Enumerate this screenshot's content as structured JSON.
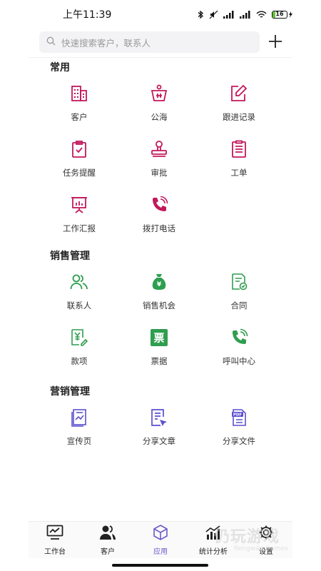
{
  "status_bar": {
    "time": "上午11:39",
    "battery": "16"
  },
  "search": {
    "placeholder": "快速搜索客户，联系人"
  },
  "sections": [
    {
      "title": "常用",
      "items": [
        {
          "label": "客户",
          "icon": "building-icon",
          "color": "#c2185b"
        },
        {
          "label": "公海",
          "icon": "pool-basket-icon",
          "color": "#c2185b"
        },
        {
          "label": "跟进记录",
          "icon": "edit-note-icon",
          "color": "#c2185b"
        },
        {
          "label": "任务提醒",
          "icon": "task-clipboard-icon",
          "color": "#c2185b"
        },
        {
          "label": "审批",
          "icon": "stamp-icon",
          "color": "#c2185b"
        },
        {
          "label": "工单",
          "icon": "work-order-icon",
          "color": "#c2185b"
        },
        {
          "label": "工作汇报",
          "icon": "report-board-icon",
          "color": "#c2185b"
        },
        {
          "label": "拨打电话",
          "icon": "phone-call-icon",
          "color": "#c2185b"
        }
      ]
    },
    {
      "title": "销售管理",
      "items": [
        {
          "label": "联系人",
          "icon": "contacts-icon",
          "color": "#2e9e4f"
        },
        {
          "label": "销售机会",
          "icon": "money-bag-icon",
          "color": "#2e9e4f"
        },
        {
          "label": "合同",
          "icon": "contract-icon",
          "color": "#2e9e4f"
        },
        {
          "label": "款项",
          "icon": "payment-icon",
          "color": "#2e9e4f"
        },
        {
          "label": "票据",
          "icon": "invoice-icon",
          "color": "#2e9e4f",
          "glyph": "票"
        },
        {
          "label": "呼叫中心",
          "icon": "call-center-icon",
          "color": "#2e9e4f"
        }
      ]
    },
    {
      "title": "营销管理",
      "items": [
        {
          "label": "宣传页",
          "icon": "flyer-icon",
          "color": "#5b4fcf"
        },
        {
          "label": "分享文章",
          "icon": "share-article-icon",
          "color": "#5b4fcf"
        },
        {
          "label": "分享文件",
          "icon": "pdf-file-icon",
          "color": "#5b4fcf",
          "glyph": "PDF"
        }
      ]
    }
  ],
  "bottom_nav": [
    {
      "label": "工作台",
      "icon": "dashboard-icon",
      "active": false
    },
    {
      "label": "客户",
      "icon": "customers-icon",
      "active": false
    },
    {
      "label": "应用",
      "icon": "apps-cube-icon",
      "active": true
    },
    {
      "label": "统计分析",
      "icon": "statistics-icon",
      "active": false
    },
    {
      "label": "设置",
      "icon": "settings-gear-icon",
      "active": false
    }
  ],
  "watermark": {
    "title": "仍玩游戏",
    "subtitle": "Rengwan Games"
  },
  "colors": {
    "common": "#c2185b",
    "sales": "#2e9e4f",
    "marketing": "#5b4fcf",
    "active_nav": "#6a5acd"
  }
}
